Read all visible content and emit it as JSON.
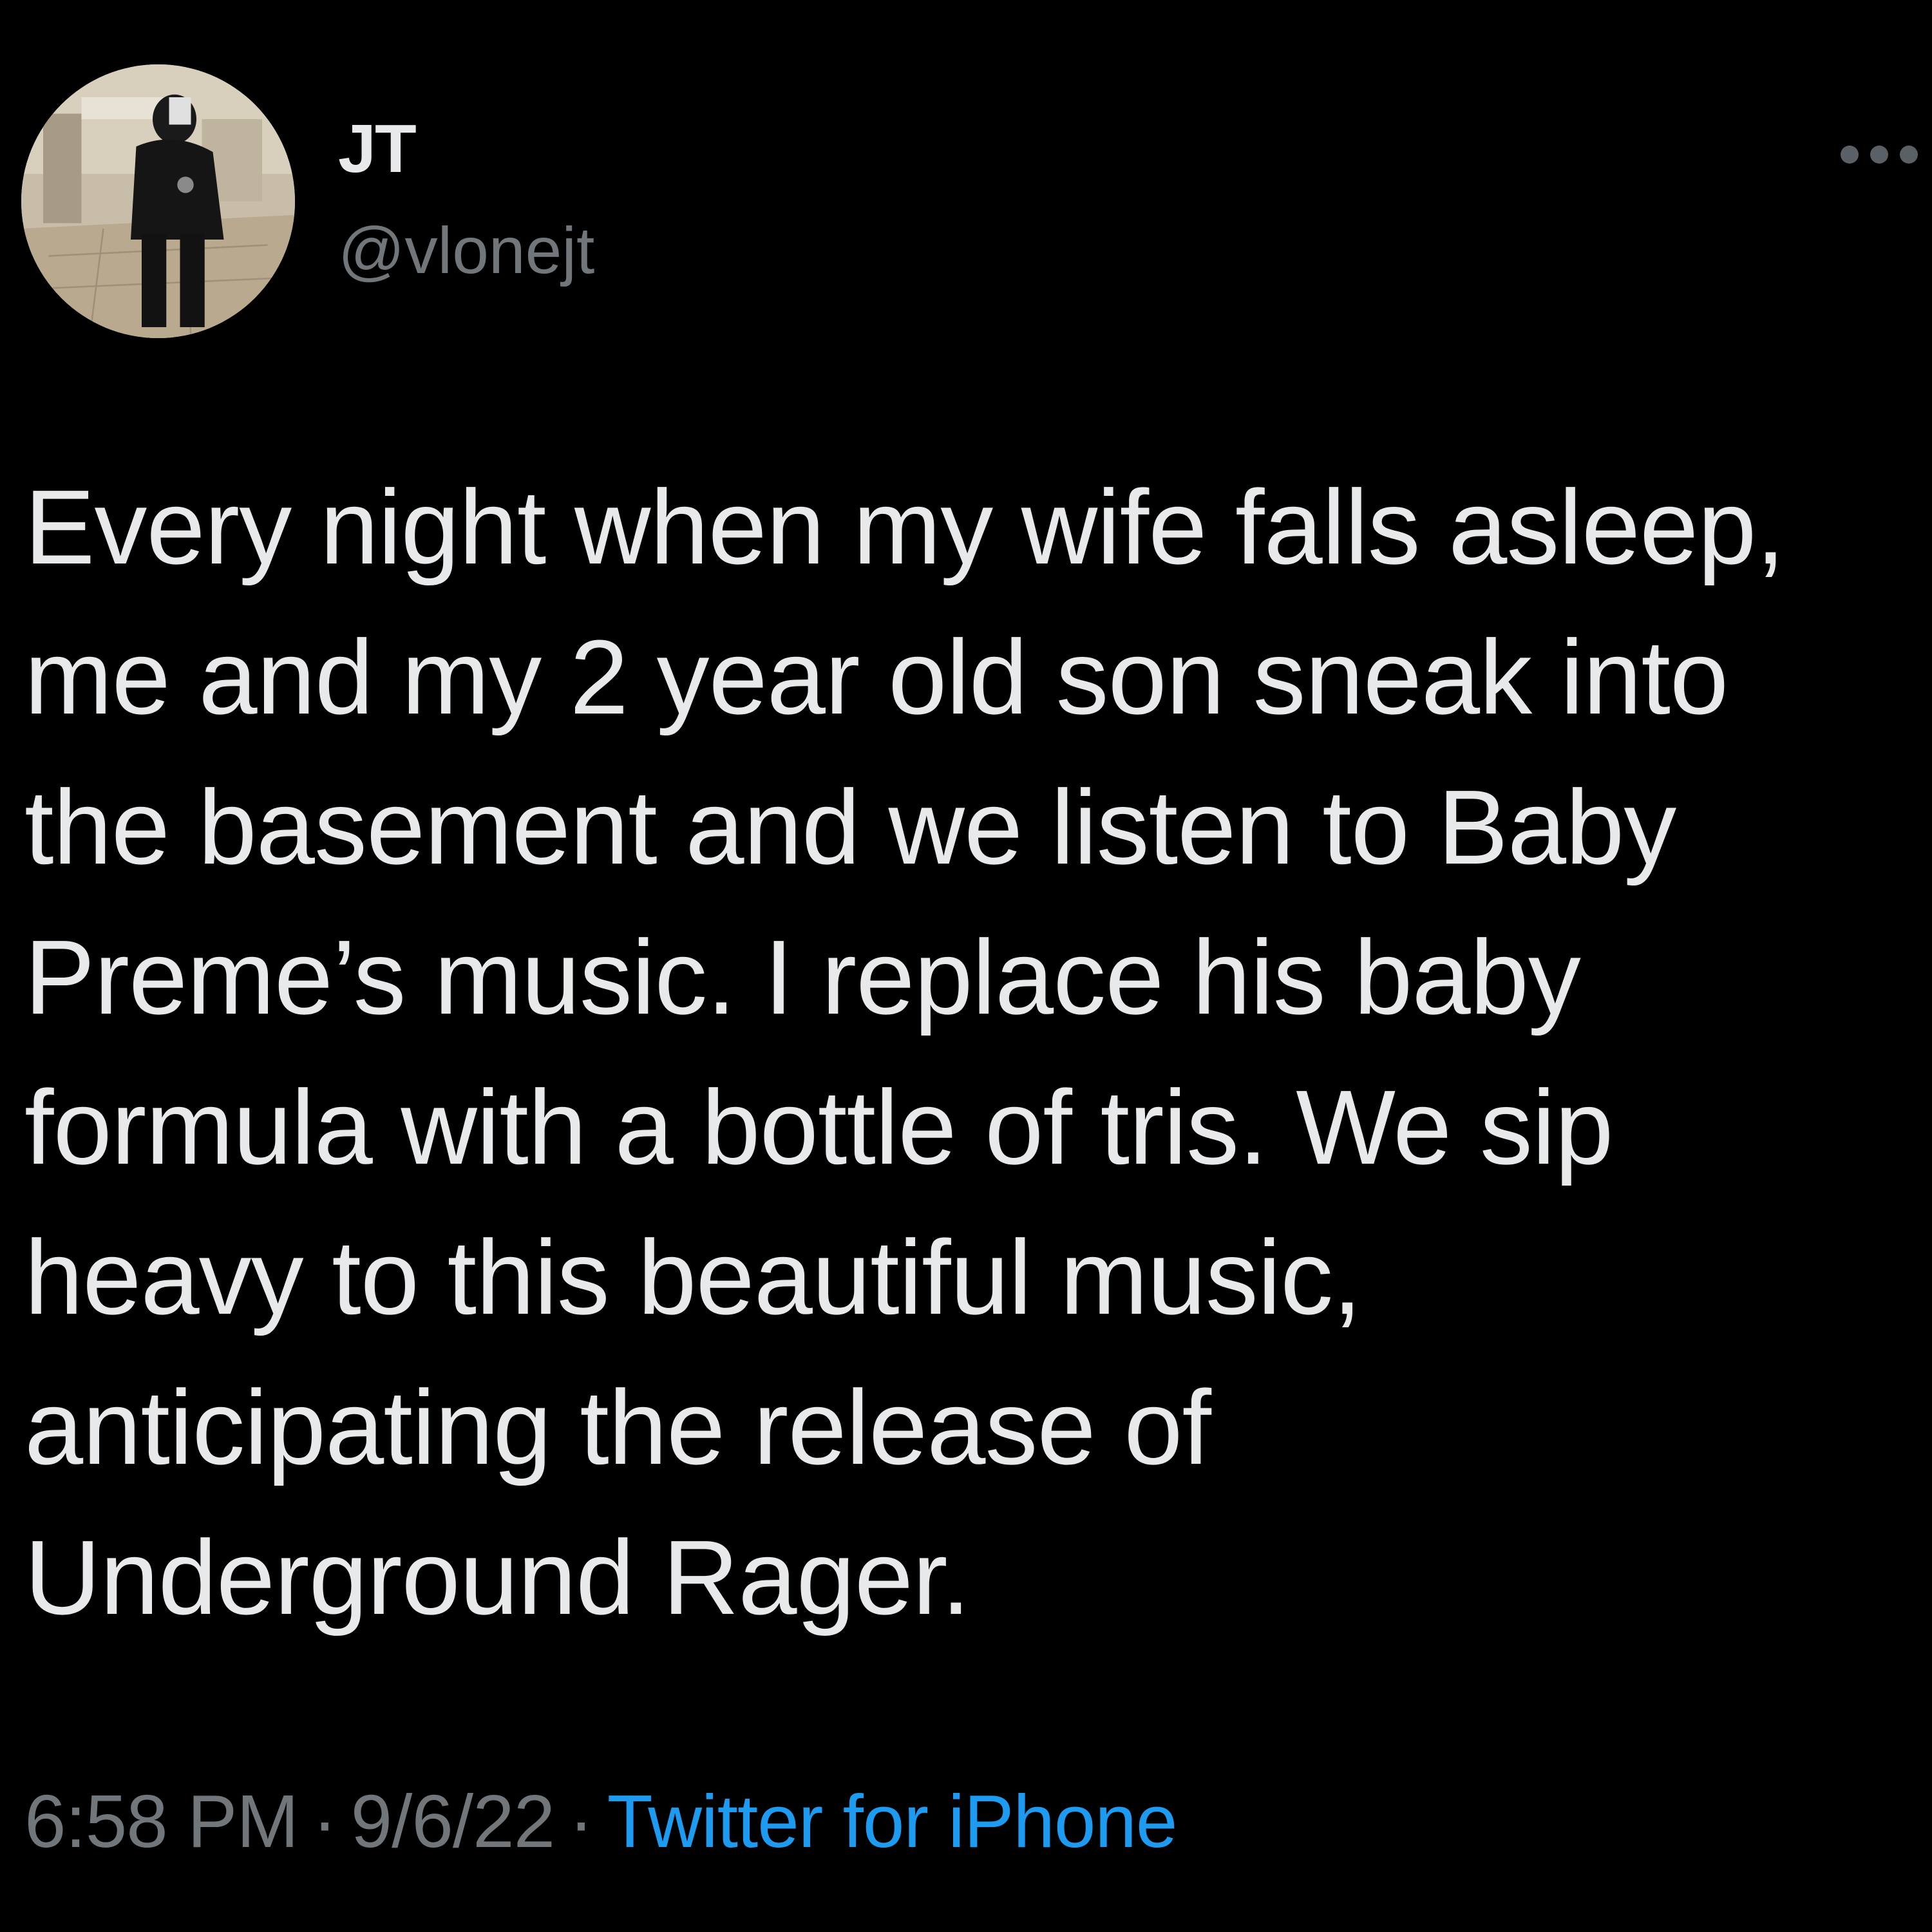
{
  "author": {
    "display_name": "JT",
    "handle": "@vlonejt"
  },
  "tweet": {
    "lines": [
      "Every night when my wife falls asleep,",
      "me and my 2 year old son sneak into",
      "the basement and we listen to Baby",
      "Preme’s music. I replace his baby",
      "formula with a bottle of tris. We sip",
      "heavy to this beautiful music,",
      "anticipating the release of",
      "Underground Rager."
    ]
  },
  "meta": {
    "time": "6:58 PM",
    "separator": "·",
    "date": "9/6/22",
    "source": "Twitter for iPhone"
  },
  "colors": {
    "background": "#000000",
    "primary_text": "#e7e9ea",
    "secondary_text": "#71767b",
    "link": "#1d9bf0"
  },
  "icons": {
    "more": "more-horizontal-icon"
  }
}
